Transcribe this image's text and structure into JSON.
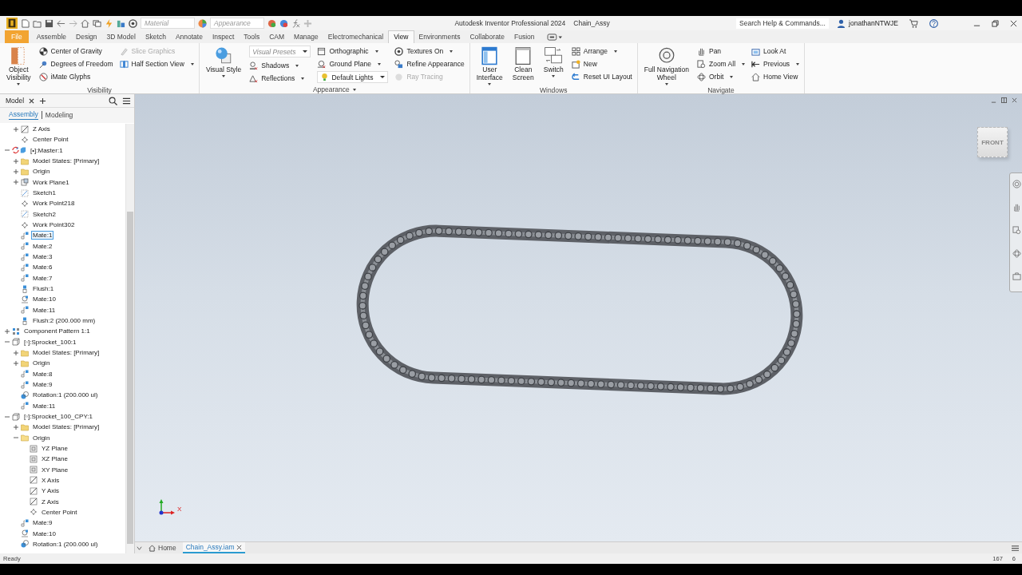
{
  "title_bar": {
    "material_dropdown": "Material",
    "appearance_dropdown": "Appearance",
    "app_title": "Autodesk Inventor Professional 2024",
    "document": "Chain_Assy",
    "search": {
      "placeholder": "Search Help & Commands..."
    },
    "user": "jonathanNTWJE"
  },
  "ribbon_tabs": [
    {
      "label": "File",
      "kind": "file",
      "selected": false
    },
    {
      "label": "Assemble",
      "kind": "tab",
      "selected": false
    },
    {
      "label": "Design",
      "kind": "tab",
      "selected": false
    },
    {
      "label": "3D Model",
      "kind": "tab",
      "selected": false
    },
    {
      "label": "Sketch",
      "kind": "tab",
      "selected": false
    },
    {
      "label": "Annotate",
      "kind": "tab",
      "selected": false
    },
    {
      "label": "Inspect",
      "kind": "tab",
      "selected": false
    },
    {
      "label": "Tools",
      "kind": "tab",
      "selected": false
    },
    {
      "label": "CAM",
      "kind": "tab",
      "selected": false
    },
    {
      "label": "Manage",
      "kind": "tab",
      "selected": false
    },
    {
      "label": "Electromechanical",
      "kind": "tab",
      "selected": false
    },
    {
      "label": "View",
      "kind": "tab",
      "selected": true
    },
    {
      "label": "Environments",
      "kind": "tab",
      "selected": false
    },
    {
      "label": "Collaborate",
      "kind": "tab",
      "selected": false
    },
    {
      "label": "Fusion",
      "kind": "tab",
      "selected": false
    }
  ],
  "ribbon_panels": [
    {
      "title": "Visibility",
      "dropdown": false,
      "columns": [
        [
          {
            "kind": "large",
            "label": "Object\nVisibility",
            "dropdown": true,
            "disabled": false
          }
        ],
        [
          {
            "kind": "small",
            "label": "Center of Gravity",
            "dropdown": false,
            "disabled": false
          },
          {
            "kind": "small",
            "label": "Degrees of Freedom",
            "dropdown": false,
            "disabled": false
          },
          {
            "kind": "small",
            "label": "iMate Glyphs",
            "dropdown": false,
            "disabled": false
          }
        ],
        [
          {
            "kind": "small",
            "label": "Slice Graphics",
            "dropdown": false,
            "disabled": true
          },
          {
            "kind": "small",
            "label": "Half Section View",
            "dropdown": true,
            "disabled": false
          }
        ]
      ]
    },
    {
      "title": "Appearance",
      "dropdown": true,
      "columns": [
        [
          {
            "kind": "large",
            "label": "Visual Style",
            "dropdown": true,
            "disabled": false
          }
        ],
        [
          {
            "kind": "combo",
            "placeholder": "Visual Presets"
          },
          {
            "kind": "small",
            "label": "Shadows",
            "dropdown": true,
            "disabled": false
          },
          {
            "kind": "small",
            "label": "Reflections",
            "dropdown": true,
            "disabled": false
          }
        ],
        [
          {
            "kind": "small",
            "label": "Orthographic",
            "dropdown": true,
            "disabled": false
          },
          {
            "kind": "small",
            "label": "Ground Plane",
            "dropdown": true,
            "disabled": false
          },
          {
            "kind": "combo",
            "value": "Default Lights"
          }
        ],
        [
          {
            "kind": "small",
            "label": "Textures On",
            "dropdown": true,
            "disabled": false
          },
          {
            "kind": "small",
            "label": "Refine Appearance",
            "dropdown": false,
            "disabled": false
          },
          {
            "kind": "small",
            "label": "Ray Tracing",
            "dropdown": false,
            "disabled": true
          }
        ]
      ]
    },
    {
      "title": "Windows",
      "dropdown": false,
      "columns": [
        [
          {
            "kind": "large",
            "label": "User\nInterface",
            "dropdown": true,
            "disabled": false
          }
        ],
        [
          {
            "kind": "large",
            "label": "Clean\nScreen",
            "dropdown": false,
            "disabled": false
          }
        ],
        [
          {
            "kind": "large",
            "label": "Switch",
            "dropdown": true,
            "disabled": false
          }
        ],
        [
          {
            "kind": "small",
            "label": "Arrange",
            "dropdown": true,
            "disabled": false
          },
          {
            "kind": "small",
            "label": "New",
            "dropdown": false,
            "disabled": false
          },
          {
            "kind": "small",
            "label": "Reset UI Layout",
            "dropdown": false,
            "disabled": false
          }
        ]
      ]
    },
    {
      "title": "Navigate",
      "dropdown": false,
      "columns": [
        [
          {
            "kind": "large",
            "label": "Full Navigation\nWheel",
            "dropdown": true,
            "disabled": false
          }
        ],
        [
          {
            "kind": "small",
            "label": "Pan",
            "dropdown": false,
            "disabled": false
          },
          {
            "kind": "small",
            "label": "Zoom All",
            "dropdown": true,
            "disabled": false
          },
          {
            "kind": "small",
            "label": "Orbit",
            "dropdown": true,
            "disabled": false
          }
        ],
        [
          {
            "kind": "small",
            "label": "Look At",
            "dropdown": false,
            "disabled": false
          },
          {
            "kind": "small",
            "label": "Previous",
            "dropdown": true,
            "disabled": false
          },
          {
            "kind": "small",
            "label": "Home View",
            "dropdown": false,
            "disabled": false
          }
        ]
      ]
    }
  ],
  "browser": {
    "tab": "Model",
    "subtabs": [
      {
        "label": "Assembly",
        "selected": true
      },
      {
        "label": "Modeling",
        "selected": false
      }
    ],
    "tree": [
      {
        "children": [
          {
            "label": "Z Axis",
            "kind": "axis",
            "expanded": false,
            "selected": false
          },
          {
            "label": "Center Point",
            "kind": "point",
            "selected": false
          }
        ]
      },
      {
        "label": "[•]:Master:1",
        "kind": "assembly",
        "expanded": true,
        "selected": false,
        "children": [
          {
            "label": "Model States: [Primary]",
            "kind": "folder",
            "expanded": false,
            "selected": false
          },
          {
            "label": "Origin",
            "kind": "folder",
            "expanded": false,
            "selected": false
          },
          {
            "label": "Work Plane1",
            "kind": "workplane",
            "expanded": false,
            "selected": false
          },
          {
            "label": "Sketch1",
            "kind": "sketch",
            "selected": false
          },
          {
            "label": "Work Point218",
            "kind": "point",
            "selected": false
          },
          {
            "label": "Sketch2",
            "kind": "sketch",
            "selected": false
          },
          {
            "label": "Work Point302",
            "kind": "point",
            "selected": false
          },
          {
            "label": "Mate:1",
            "kind": "mate",
            "selected": true
          },
          {
            "label": "Mate:2",
            "kind": "mate",
            "selected": false
          },
          {
            "label": "Mate:3",
            "kind": "mate",
            "selected": false
          },
          {
            "label": "Mate:6",
            "kind": "mate",
            "selected": false
          },
          {
            "label": "Mate:7",
            "kind": "mate",
            "selected": false
          },
          {
            "label": "Flush:1",
            "kind": "flush",
            "selected": false
          },
          {
            "label": "Mate:10",
            "kind": "tangent",
            "selected": false
          },
          {
            "label": "Mate:11",
            "kind": "mate",
            "selected": false
          },
          {
            "label": "Flush:2 (200.000 mm)",
            "kind": "flush",
            "selected": false
          }
        ]
      },
      {
        "label": "Component Pattern 1:1",
        "kind": "pattern",
        "expanded": false,
        "selected": false
      },
      {
        "label": "[◦]:Sprocket_100:1",
        "kind": "part",
        "expanded": true,
        "selected": false,
        "children": [
          {
            "label": "Model States: [Primary]",
            "kind": "folder",
            "expanded": false,
            "selected": false
          },
          {
            "label": "Origin",
            "kind": "folder",
            "expanded": false,
            "selected": false
          },
          {
            "label": "Mate:8",
            "kind": "mate",
            "selected": false
          },
          {
            "label": "Mate:9",
            "kind": "mate",
            "selected": false
          },
          {
            "label": "Rotation:1 (200.000 ul)",
            "kind": "rotation",
            "selected": false
          },
          {
            "label": "Mate:11",
            "kind": "mate",
            "selected": false
          }
        ]
      },
      {
        "label": "[◦]:Sprocket_100_CPY:1",
        "kind": "part",
        "expanded": true,
        "selected": false,
        "children": [
          {
            "label": "Model States: [Primary]",
            "kind": "folder",
            "expanded": false,
            "selected": false
          },
          {
            "label": "Origin",
            "kind": "folder",
            "expanded": true,
            "selected": false,
            "children": [
              {
                "label": "YZ Plane",
                "kind": "plane",
                "selected": false
              },
              {
                "label": "XZ Plane",
                "kind": "plane",
                "selected": false
              },
              {
                "label": "XY Plane",
                "kind": "plane",
                "selected": false
              },
              {
                "label": "X Axis",
                "kind": "axis",
                "selected": false
              },
              {
                "label": "Y Axis",
                "kind": "axis",
                "selected": false
              },
              {
                "label": "Z Axis",
                "kind": "axis",
                "selected": false
              },
              {
                "label": "Center Point",
                "kind": "point",
                "selected": false
              }
            ]
          },
          {
            "label": "Mate:9",
            "kind": "mate",
            "selected": false
          },
          {
            "label": "Mate:10",
            "kind": "tangent",
            "selected": false
          },
          {
            "label": "Rotation:1 (200.000 ul)",
            "kind": "rotation",
            "selected": false
          }
        ]
      }
    ]
  },
  "viewport": {
    "view_cube": "FRONT",
    "triad_label": "X"
  },
  "document_tabs": [
    {
      "label": "Home",
      "kind": "home",
      "selected": false
    },
    {
      "label": "Chain_Assy.iam",
      "kind": "document",
      "selected": true
    }
  ],
  "status_bar": {
    "message": "Ready",
    "readouts": [
      "167",
      "6"
    ]
  }
}
